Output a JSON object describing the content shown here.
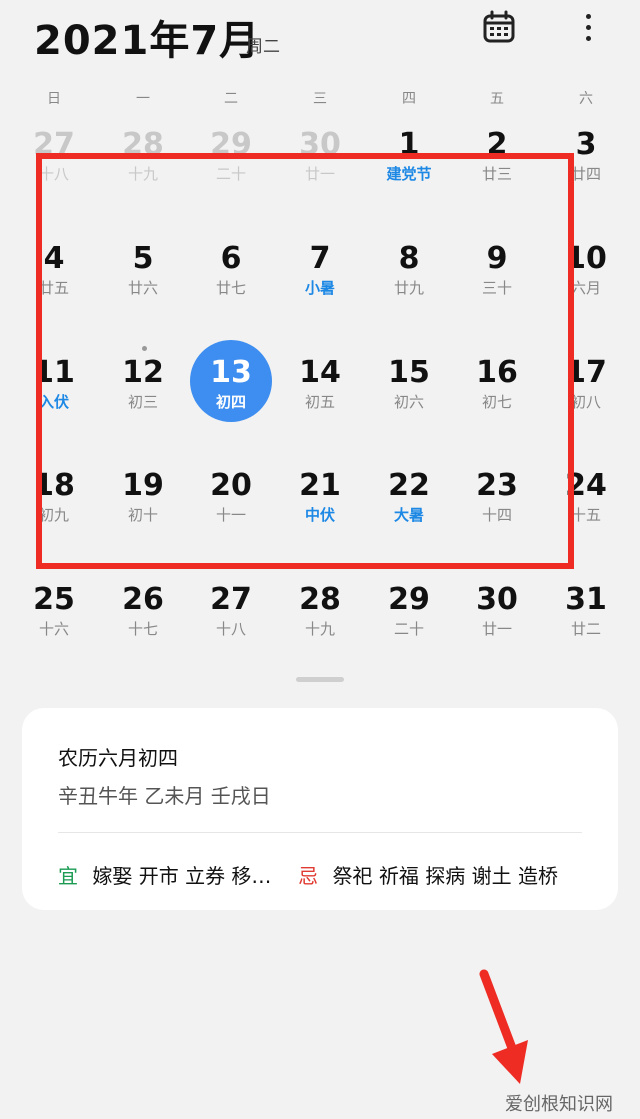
{
  "header": {
    "title": "2021年7月",
    "weekday": "周二"
  },
  "week_days": [
    "日",
    "一",
    "二",
    "三",
    "四",
    "五",
    "六"
  ],
  "weeks": [
    [
      {
        "day": "27",
        "lunar": "十八",
        "faded": true
      },
      {
        "day": "28",
        "lunar": "十九",
        "faded": true
      },
      {
        "day": "29",
        "lunar": "二十",
        "faded": true
      },
      {
        "day": "30",
        "lunar": "廿一",
        "faded": true
      },
      {
        "day": "1",
        "lunar": "建党节",
        "festival": true
      },
      {
        "day": "2",
        "lunar": "廿三"
      },
      {
        "day": "3",
        "lunar": "廿四"
      }
    ],
    [
      {
        "day": "4",
        "lunar": "廿五"
      },
      {
        "day": "5",
        "lunar": "廿六"
      },
      {
        "day": "6",
        "lunar": "廿七"
      },
      {
        "day": "7",
        "lunar": "小暑",
        "festival": true
      },
      {
        "day": "8",
        "lunar": "廿九"
      },
      {
        "day": "9",
        "lunar": "三十"
      },
      {
        "day": "10",
        "lunar": "六月"
      }
    ],
    [
      {
        "day": "11",
        "lunar": "入伏",
        "festival": true
      },
      {
        "day": "12",
        "lunar": "初三",
        "event": true
      },
      {
        "day": "13",
        "lunar": "初四",
        "selected": true
      },
      {
        "day": "14",
        "lunar": "初五"
      },
      {
        "day": "15",
        "lunar": "初六"
      },
      {
        "day": "16",
        "lunar": "初七"
      },
      {
        "day": "17",
        "lunar": "初八"
      }
    ],
    [
      {
        "day": "18",
        "lunar": "初九"
      },
      {
        "day": "19",
        "lunar": "初十"
      },
      {
        "day": "20",
        "lunar": "十一"
      },
      {
        "day": "21",
        "lunar": "中伏",
        "festival": true
      },
      {
        "day": "22",
        "lunar": "大暑",
        "festival": true
      },
      {
        "day": "23",
        "lunar": "十四"
      },
      {
        "day": "24",
        "lunar": "十五"
      }
    ],
    [
      {
        "day": "25",
        "lunar": "十六"
      },
      {
        "day": "26",
        "lunar": "十七"
      },
      {
        "day": "27",
        "lunar": "十八"
      },
      {
        "day": "28",
        "lunar": "十九"
      },
      {
        "day": "29",
        "lunar": "二十"
      },
      {
        "day": "30",
        "lunar": "廿一"
      },
      {
        "day": "31",
        "lunar": "廿二"
      }
    ]
  ],
  "detail_card": {
    "lunar_date": "农历六月初四",
    "ganzhi": "辛丑牛年 乙未月 壬戌日",
    "yi_label": "宜",
    "yi_items": "嫁娶 开市 立券 移…",
    "ji_label": "忌",
    "ji_items": "祭祀 祈福 探病 谢土 造桥"
  },
  "icons": {
    "calendar": "calendar-icon",
    "more": "more-vertical-icon"
  },
  "colors": {
    "selected": "#3d8ef0",
    "festival": "#1e88e5",
    "highlight_box": "#ee2c24",
    "yi": "#1a9a52",
    "ji": "#e03a32"
  },
  "watermark": "爱创根知识网"
}
